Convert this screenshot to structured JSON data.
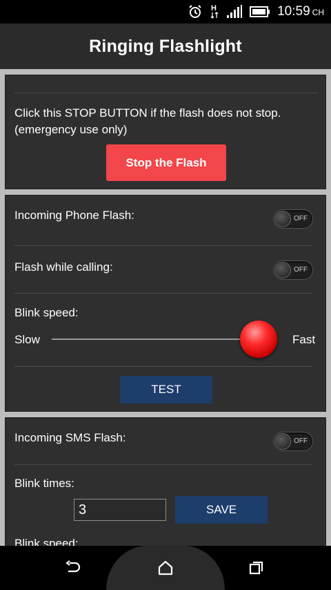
{
  "status_bar": {
    "network": "H",
    "time": "10:59",
    "time_suffix": "CH"
  },
  "app": {
    "title": "Ringing Flashlight"
  },
  "stop_section": {
    "message": "Click this STOP BUTTON if the flash does not stop. (emergency use only)",
    "stop_button_label": "Stop the Flash"
  },
  "phone_section": {
    "incoming_label": "Incoming Phone Flash:",
    "incoming_toggle": "OFF",
    "calling_label": "Flash while calling:",
    "calling_toggle": "OFF",
    "blink_speed_label": "Blink speed:",
    "slow_label": "Slow",
    "fast_label": "Fast",
    "blink_speed_level": 1.0,
    "test_button_label": "TEST"
  },
  "sms_section": {
    "incoming_label": "Incoming SMS Flash:",
    "incoming_toggle": "OFF",
    "blink_times_label": "Blink times:",
    "blink_times_value": "3",
    "save_button_label": "SAVE",
    "blink_speed_label": "Blink speed:"
  },
  "icons": {
    "alarm": "alarm-clock-icon",
    "signal": "signal-icon",
    "battery": "battery-icon",
    "back": "back-icon",
    "home": "home-icon",
    "recents": "recents-icon"
  },
  "colors": {
    "stop_button": "#f2464b",
    "action_button": "#1d3d6b",
    "card_background": "#2f2f2f",
    "app_bar": "#2b2b2b"
  }
}
